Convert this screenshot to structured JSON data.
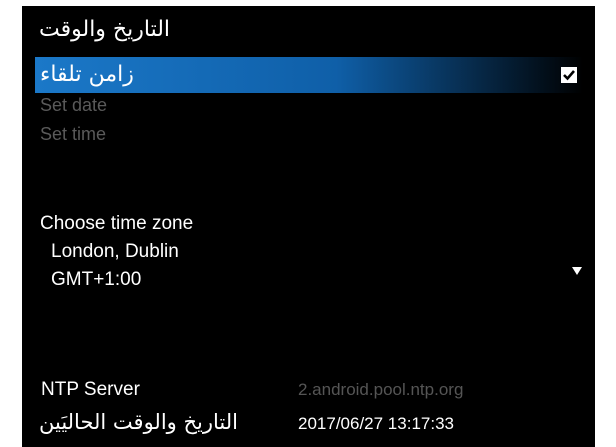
{
  "title": "التاريخ والوقت",
  "auto_sync": {
    "label": "زامن تلقاء",
    "checked": true,
    "highlight_color": "#1b78c8"
  },
  "set_date_label": "Set date",
  "set_time_label": "Set time",
  "time_zone": {
    "label": "Choose time zone",
    "city": "London, Dublin",
    "offset": "GMT+1:00"
  },
  "ntp": {
    "label": "NTP Server",
    "value": "2.android.pool.ntp.org"
  },
  "current": {
    "label": "التاريخ والوقت الحاليَين",
    "value": "2017/06/27 13:17:33"
  },
  "icons": {
    "checkbox": "checkbox-checked-icon",
    "dropdown": "dropdown-arrow-icon"
  }
}
